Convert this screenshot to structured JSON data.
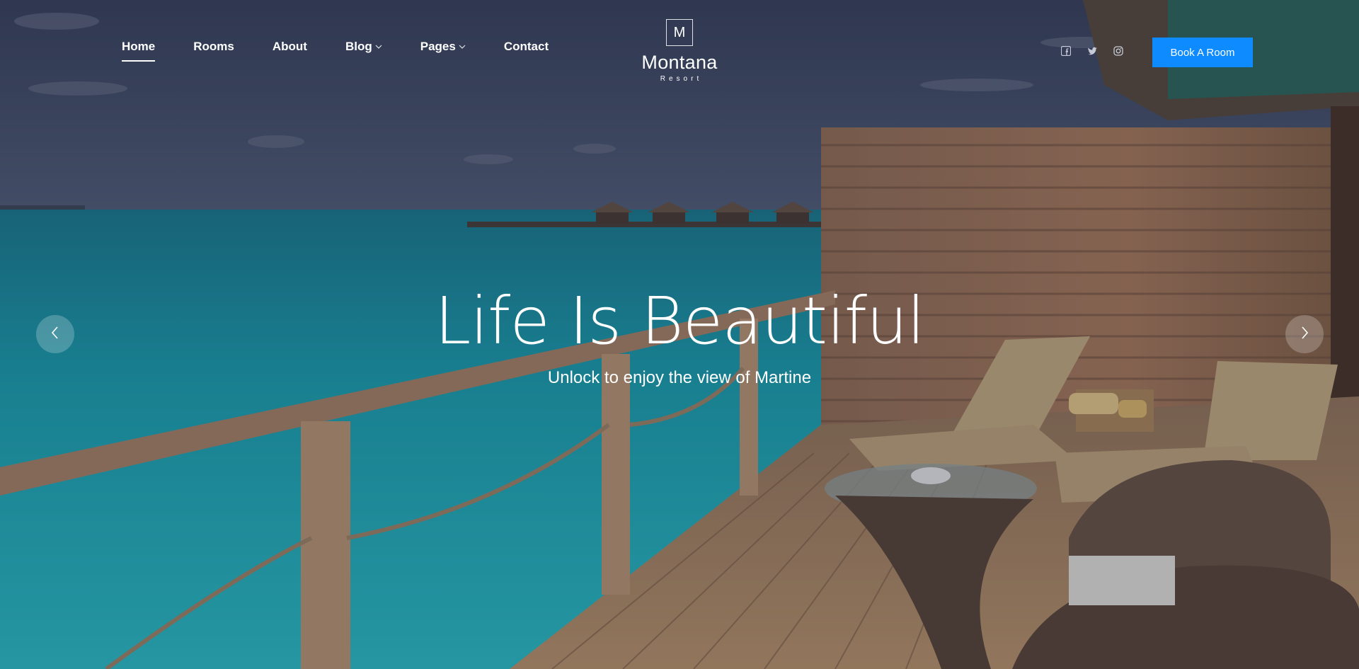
{
  "nav": {
    "items": [
      {
        "label": "Home",
        "active": true,
        "has_dropdown": false
      },
      {
        "label": "Rooms",
        "active": false,
        "has_dropdown": false
      },
      {
        "label": "About",
        "active": false,
        "has_dropdown": false
      },
      {
        "label": "Blog",
        "active": false,
        "has_dropdown": true
      },
      {
        "label": "Pages",
        "active": false,
        "has_dropdown": true
      },
      {
        "label": "Contact",
        "active": false,
        "has_dropdown": false
      }
    ]
  },
  "logo": {
    "letter": "M",
    "name": "Montana",
    "subtitle": "Resort"
  },
  "social": [
    "facebook-icon",
    "twitter-icon",
    "instagram-icon"
  ],
  "header": {
    "book_label": "Book A Room"
  },
  "hero": {
    "title": "Life Is Beautiful",
    "subtitle": "Unlock to enjoy the view of Martine"
  },
  "slider": {
    "prev_icon": "chevron-left-icon",
    "next_icon": "chevron-right-icon"
  },
  "colors": {
    "accent": "#0d8bff",
    "text": "#ffffff"
  }
}
